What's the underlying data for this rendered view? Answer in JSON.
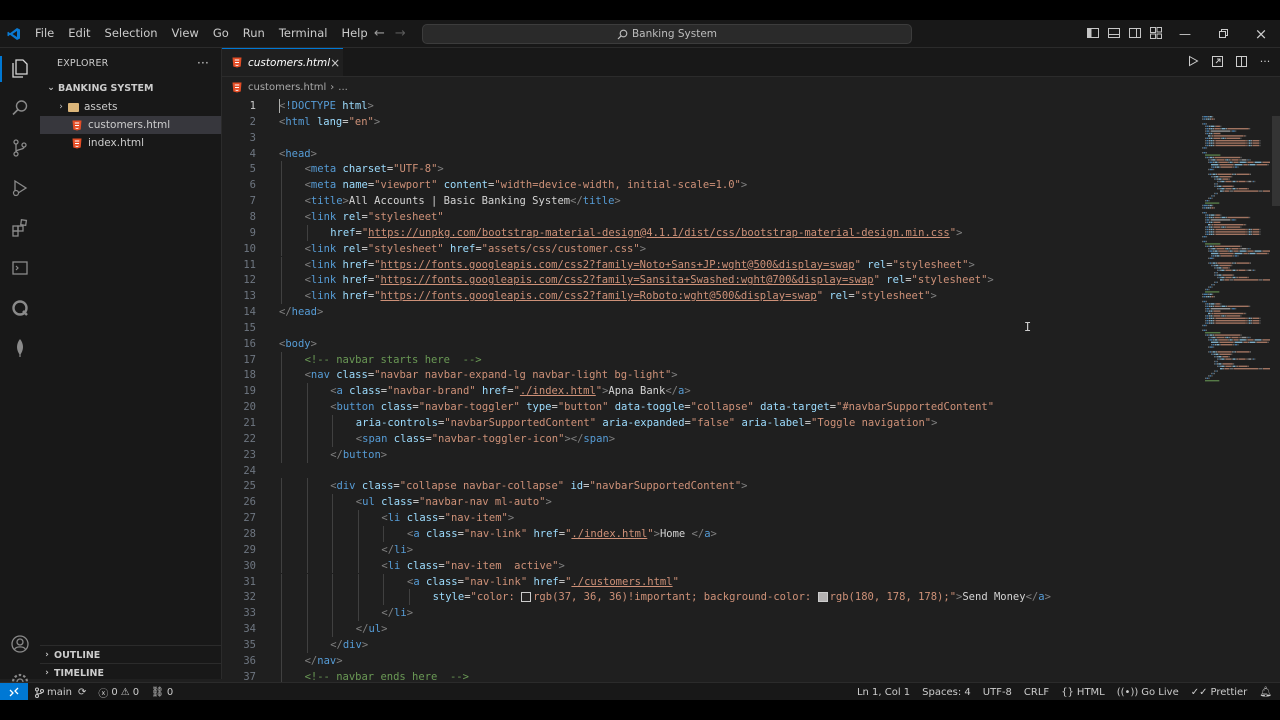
{
  "titlebar": {
    "menu": [
      "File",
      "Edit",
      "Selection",
      "View",
      "Go",
      "Run",
      "Terminal",
      "Help"
    ],
    "search_text": "Banking System"
  },
  "explorer": {
    "title": "EXPLORER",
    "more": "···",
    "project": "BANKING SYSTEM",
    "items": [
      {
        "label": "assets",
        "type": "folder"
      },
      {
        "label": "customers.html",
        "type": "file",
        "selected": true
      },
      {
        "label": "index.html",
        "type": "file"
      }
    ],
    "outline": "OUTLINE",
    "timeline": "TIMELINE"
  },
  "editor": {
    "tab_label": "customers.html",
    "tab_close": "×",
    "breadcrumb_file": "customers.html",
    "breadcrumb_more": "...",
    "current_line": 1
  },
  "code": [
    {
      "n": 1,
      "indent": 0,
      "tokens": [
        [
          "br",
          "<"
        ],
        [
          "tag",
          "!DOCTYPE"
        ],
        [
          "txt",
          " "
        ],
        [
          "at",
          "html"
        ],
        [
          "br",
          ">"
        ]
      ]
    },
    {
      "n": 2,
      "indent": 0,
      "tokens": [
        [
          "br",
          "<"
        ],
        [
          "tag",
          "html"
        ],
        [
          "txt",
          " "
        ],
        [
          "at",
          "lang"
        ],
        [
          "txt",
          "="
        ],
        [
          "str",
          "\"en\""
        ],
        [
          "br",
          ">"
        ]
      ]
    },
    {
      "n": 3,
      "indent": 0,
      "tokens": []
    },
    {
      "n": 4,
      "indent": 0,
      "tokens": [
        [
          "br",
          "<"
        ],
        [
          "tag",
          "head"
        ],
        [
          "br",
          ">"
        ]
      ]
    },
    {
      "n": 5,
      "indent": 1,
      "tokens": [
        [
          "br",
          "<"
        ],
        [
          "tag",
          "meta"
        ],
        [
          "txt",
          " "
        ],
        [
          "at",
          "charset"
        ],
        [
          "txt",
          "="
        ],
        [
          "str",
          "\"UTF-8\""
        ],
        [
          "br",
          ">"
        ]
      ]
    },
    {
      "n": 6,
      "indent": 1,
      "tokens": [
        [
          "br",
          "<"
        ],
        [
          "tag",
          "meta"
        ],
        [
          "txt",
          " "
        ],
        [
          "at",
          "name"
        ],
        [
          "txt",
          "="
        ],
        [
          "str",
          "\"viewport\""
        ],
        [
          "txt",
          " "
        ],
        [
          "at",
          "content"
        ],
        [
          "txt",
          "="
        ],
        [
          "str",
          "\"width=device-width, initial-scale=1.0\""
        ],
        [
          "br",
          ">"
        ]
      ]
    },
    {
      "n": 7,
      "indent": 1,
      "tokens": [
        [
          "br",
          "<"
        ],
        [
          "tag",
          "title"
        ],
        [
          "br",
          ">"
        ],
        [
          "txt",
          "All Accounts | Basic Banking System"
        ],
        [
          "br",
          "</"
        ],
        [
          "tag",
          "title"
        ],
        [
          "br",
          ">"
        ]
      ]
    },
    {
      "n": 8,
      "indent": 1,
      "tokens": [
        [
          "br",
          "<"
        ],
        [
          "tag",
          "link"
        ],
        [
          "txt",
          " "
        ],
        [
          "at",
          "rel"
        ],
        [
          "txt",
          "="
        ],
        [
          "str",
          "\"stylesheet\""
        ]
      ]
    },
    {
      "n": 9,
      "indent": 2,
      "tokens": [
        [
          "at",
          "href"
        ],
        [
          "txt",
          "="
        ],
        [
          "str",
          "\""
        ],
        [
          "url",
          "https://unpkg.com/bootstrap-material-design@4.1.1/dist/css/bootstrap-material-design.min.css"
        ],
        [
          "str",
          "\""
        ],
        [
          "br",
          ">"
        ]
      ]
    },
    {
      "n": 10,
      "indent": 1,
      "tokens": [
        [
          "br",
          "<"
        ],
        [
          "tag",
          "link"
        ],
        [
          "txt",
          " "
        ],
        [
          "at",
          "rel"
        ],
        [
          "txt",
          "="
        ],
        [
          "str",
          "\"stylesheet\""
        ],
        [
          "txt",
          " "
        ],
        [
          "at",
          "href"
        ],
        [
          "txt",
          "="
        ],
        [
          "str",
          "\"assets/css/customer.css\""
        ],
        [
          "br",
          ">"
        ]
      ]
    },
    {
      "n": 11,
      "indent": 1,
      "tokens": [
        [
          "br",
          "<"
        ],
        [
          "tag",
          "link"
        ],
        [
          "txt",
          " "
        ],
        [
          "at",
          "href"
        ],
        [
          "txt",
          "="
        ],
        [
          "str",
          "\""
        ],
        [
          "url",
          "https://fonts.googleapis.com/css2?family=Noto+Sans+JP:wght@500&display=swap"
        ],
        [
          "str",
          "\""
        ],
        [
          "txt",
          " "
        ],
        [
          "at",
          "rel"
        ],
        [
          "txt",
          "="
        ],
        [
          "str",
          "\"stylesheet\""
        ],
        [
          "br",
          ">"
        ]
      ]
    },
    {
      "n": 12,
      "indent": 1,
      "tokens": [
        [
          "br",
          "<"
        ],
        [
          "tag",
          "link"
        ],
        [
          "txt",
          " "
        ],
        [
          "at",
          "href"
        ],
        [
          "txt",
          "="
        ],
        [
          "str",
          "\""
        ],
        [
          "url",
          "https://fonts.googleapis.com/css2?family=Sansita+Swashed:wght@700&display=swap"
        ],
        [
          "str",
          "\""
        ],
        [
          "txt",
          " "
        ],
        [
          "at",
          "rel"
        ],
        [
          "txt",
          "="
        ],
        [
          "str",
          "\"stylesheet\""
        ],
        [
          "br",
          ">"
        ]
      ]
    },
    {
      "n": 13,
      "indent": 1,
      "tokens": [
        [
          "br",
          "<"
        ],
        [
          "tag",
          "link"
        ],
        [
          "txt",
          " "
        ],
        [
          "at",
          "href"
        ],
        [
          "txt",
          "="
        ],
        [
          "str",
          "\""
        ],
        [
          "url",
          "https://fonts.googleapis.com/css2?family=Roboto:wght@500&display=swap"
        ],
        [
          "str",
          "\""
        ],
        [
          "txt",
          " "
        ],
        [
          "at",
          "rel"
        ],
        [
          "txt",
          "="
        ],
        [
          "str",
          "\"stylesheet\""
        ],
        [
          "br",
          ">"
        ]
      ]
    },
    {
      "n": 14,
      "indent": 0,
      "tokens": [
        [
          "br",
          "</"
        ],
        [
          "tag",
          "head"
        ],
        [
          "br",
          ">"
        ]
      ]
    },
    {
      "n": 15,
      "indent": 0,
      "tokens": []
    },
    {
      "n": 16,
      "indent": 0,
      "tokens": [
        [
          "br",
          "<"
        ],
        [
          "tag",
          "body"
        ],
        [
          "br",
          ">"
        ]
      ]
    },
    {
      "n": 17,
      "indent": 1,
      "tokens": [
        [
          "com",
          "<!-- navbar starts here  -->"
        ]
      ]
    },
    {
      "n": 18,
      "indent": 1,
      "tokens": [
        [
          "br",
          "<"
        ],
        [
          "tag",
          "nav"
        ],
        [
          "txt",
          " "
        ],
        [
          "at",
          "class"
        ],
        [
          "txt",
          "="
        ],
        [
          "str",
          "\"navbar navbar-expand-lg navbar-light bg-light\""
        ],
        [
          "br",
          ">"
        ]
      ]
    },
    {
      "n": 19,
      "indent": 2,
      "tokens": [
        [
          "br",
          "<"
        ],
        [
          "tag",
          "a"
        ],
        [
          "txt",
          " "
        ],
        [
          "at",
          "class"
        ],
        [
          "txt",
          "="
        ],
        [
          "str",
          "\"navbar-brand\""
        ],
        [
          "txt",
          " "
        ],
        [
          "at",
          "href"
        ],
        [
          "txt",
          "="
        ],
        [
          "str",
          "\""
        ],
        [
          "url",
          "./index.html"
        ],
        [
          "str",
          "\""
        ],
        [
          "br",
          ">"
        ],
        [
          "txt",
          "Apna Bank"
        ],
        [
          "br",
          "</"
        ],
        [
          "tag",
          "a"
        ],
        [
          "br",
          ">"
        ]
      ]
    },
    {
      "n": 20,
      "indent": 2,
      "tokens": [
        [
          "br",
          "<"
        ],
        [
          "tag",
          "button"
        ],
        [
          "txt",
          " "
        ],
        [
          "at",
          "class"
        ],
        [
          "txt",
          "="
        ],
        [
          "str",
          "\"navbar-toggler\""
        ],
        [
          "txt",
          " "
        ],
        [
          "at",
          "type"
        ],
        [
          "txt",
          "="
        ],
        [
          "str",
          "\"button\""
        ],
        [
          "txt",
          " "
        ],
        [
          "at",
          "data-toggle"
        ],
        [
          "txt",
          "="
        ],
        [
          "str",
          "\"collapse\""
        ],
        [
          "txt",
          " "
        ],
        [
          "at",
          "data-target"
        ],
        [
          "txt",
          "="
        ],
        [
          "str",
          "\"#navbarSupportedContent\""
        ]
      ]
    },
    {
      "n": 21,
      "indent": 3,
      "tokens": [
        [
          "at",
          "aria-controls"
        ],
        [
          "txt",
          "="
        ],
        [
          "str",
          "\"navbarSupportedContent\""
        ],
        [
          "txt",
          " "
        ],
        [
          "at",
          "aria-expanded"
        ],
        [
          "txt",
          "="
        ],
        [
          "str",
          "\"false\""
        ],
        [
          "txt",
          " "
        ],
        [
          "at",
          "aria-label"
        ],
        [
          "txt",
          "="
        ],
        [
          "str",
          "\"Toggle navigation\""
        ],
        [
          "br",
          ">"
        ]
      ]
    },
    {
      "n": 22,
      "indent": 3,
      "tokens": [
        [
          "br",
          "<"
        ],
        [
          "tag",
          "span"
        ],
        [
          "txt",
          " "
        ],
        [
          "at",
          "class"
        ],
        [
          "txt",
          "="
        ],
        [
          "str",
          "\"navbar-toggler-icon\""
        ],
        [
          "br",
          "></"
        ],
        [
          "tag",
          "span"
        ],
        [
          "br",
          ">"
        ]
      ]
    },
    {
      "n": 23,
      "indent": 2,
      "tokens": [
        [
          "br",
          "</"
        ],
        [
          "tag",
          "button"
        ],
        [
          "br",
          ">"
        ]
      ]
    },
    {
      "n": 24,
      "indent": 0,
      "tokens": []
    },
    {
      "n": 25,
      "indent": 2,
      "tokens": [
        [
          "br",
          "<"
        ],
        [
          "tag",
          "div"
        ],
        [
          "txt",
          " "
        ],
        [
          "at",
          "class"
        ],
        [
          "txt",
          "="
        ],
        [
          "str",
          "\"collapse navbar-collapse\""
        ],
        [
          "txt",
          " "
        ],
        [
          "at",
          "id"
        ],
        [
          "txt",
          "="
        ],
        [
          "str",
          "\"navbarSupportedContent\""
        ],
        [
          "br",
          ">"
        ]
      ]
    },
    {
      "n": 26,
      "indent": 3,
      "tokens": [
        [
          "br",
          "<"
        ],
        [
          "tag",
          "ul"
        ],
        [
          "txt",
          " "
        ],
        [
          "at",
          "class"
        ],
        [
          "txt",
          "="
        ],
        [
          "str",
          "\"navbar-nav ml-auto\""
        ],
        [
          "br",
          ">"
        ]
      ]
    },
    {
      "n": 27,
      "indent": 4,
      "tokens": [
        [
          "br",
          "<"
        ],
        [
          "tag",
          "li"
        ],
        [
          "txt",
          " "
        ],
        [
          "at",
          "class"
        ],
        [
          "txt",
          "="
        ],
        [
          "str",
          "\"nav-item\""
        ],
        [
          "br",
          ">"
        ]
      ]
    },
    {
      "n": 28,
      "indent": 5,
      "tokens": [
        [
          "br",
          "<"
        ],
        [
          "tag",
          "a"
        ],
        [
          "txt",
          " "
        ],
        [
          "at",
          "class"
        ],
        [
          "txt",
          "="
        ],
        [
          "str",
          "\"nav-link\""
        ],
        [
          "txt",
          " "
        ],
        [
          "at",
          "href"
        ],
        [
          "txt",
          "="
        ],
        [
          "str",
          "\""
        ],
        [
          "url",
          "./index.html"
        ],
        [
          "str",
          "\""
        ],
        [
          "br",
          ">"
        ],
        [
          "txt",
          "Home "
        ],
        [
          "br",
          "</"
        ],
        [
          "tag",
          "a"
        ],
        [
          "br",
          ">"
        ]
      ]
    },
    {
      "n": 29,
      "indent": 4,
      "tokens": [
        [
          "br",
          "</"
        ],
        [
          "tag",
          "li"
        ],
        [
          "br",
          ">"
        ]
      ]
    },
    {
      "n": 30,
      "indent": 4,
      "tokens": [
        [
          "br",
          "<"
        ],
        [
          "tag",
          "li"
        ],
        [
          "txt",
          " "
        ],
        [
          "at",
          "class"
        ],
        [
          "txt",
          "="
        ],
        [
          "str",
          "\"nav-item  active\""
        ],
        [
          "br",
          ">"
        ]
      ]
    },
    {
      "n": 31,
      "indent": 5,
      "tokens": [
        [
          "br",
          "<"
        ],
        [
          "tag",
          "a"
        ],
        [
          "txt",
          " "
        ],
        [
          "at",
          "class"
        ],
        [
          "txt",
          "="
        ],
        [
          "str",
          "\"nav-link\""
        ],
        [
          "txt",
          " "
        ],
        [
          "at",
          "href"
        ],
        [
          "txt",
          "="
        ],
        [
          "str",
          "\""
        ],
        [
          "url",
          "./customers.html"
        ],
        [
          "str",
          "\""
        ]
      ]
    },
    {
      "n": 32,
      "indent": 6,
      "tokens": [
        [
          "at",
          "style"
        ],
        [
          "txt",
          "="
        ],
        [
          "str",
          "\"color: "
        ],
        [
          "swatch",
          "#252424"
        ],
        [
          "str",
          "rgb(37, 36, 36)!important; background-color: "
        ],
        [
          "swatch",
          "#b4b2b2"
        ],
        [
          "str",
          "rgb(180, 178, 178);\""
        ],
        [
          "br",
          ">"
        ],
        [
          "txt",
          "Send Money"
        ],
        [
          "br",
          "</"
        ],
        [
          "tag",
          "a"
        ],
        [
          "br",
          ">"
        ]
      ]
    },
    {
      "n": 33,
      "indent": 4,
      "tokens": [
        [
          "br",
          "</"
        ],
        [
          "tag",
          "li"
        ],
        [
          "br",
          ">"
        ]
      ]
    },
    {
      "n": 34,
      "indent": 3,
      "tokens": [
        [
          "br",
          "</"
        ],
        [
          "tag",
          "ul"
        ],
        [
          "br",
          ">"
        ]
      ]
    },
    {
      "n": 35,
      "indent": 2,
      "tokens": [
        [
          "br",
          "</"
        ],
        [
          "tag",
          "div"
        ],
        [
          "br",
          ">"
        ]
      ]
    },
    {
      "n": 36,
      "indent": 1,
      "tokens": [
        [
          "br",
          "</"
        ],
        [
          "tag",
          "nav"
        ],
        [
          "br",
          ">"
        ]
      ]
    },
    {
      "n": 37,
      "indent": 1,
      "tokens": [
        [
          "com",
          "<!-- navbar ends here  -->"
        ]
      ]
    }
  ],
  "statusbar": {
    "branch": "main",
    "errors": "0",
    "warnings": "0",
    "ports": "0",
    "position": "Ln 1, Col 1",
    "spaces": "Spaces: 4",
    "encoding": "UTF-8",
    "eol": "CRLF",
    "language": "HTML",
    "golive": "Go Live",
    "prettier": "Prettier"
  }
}
